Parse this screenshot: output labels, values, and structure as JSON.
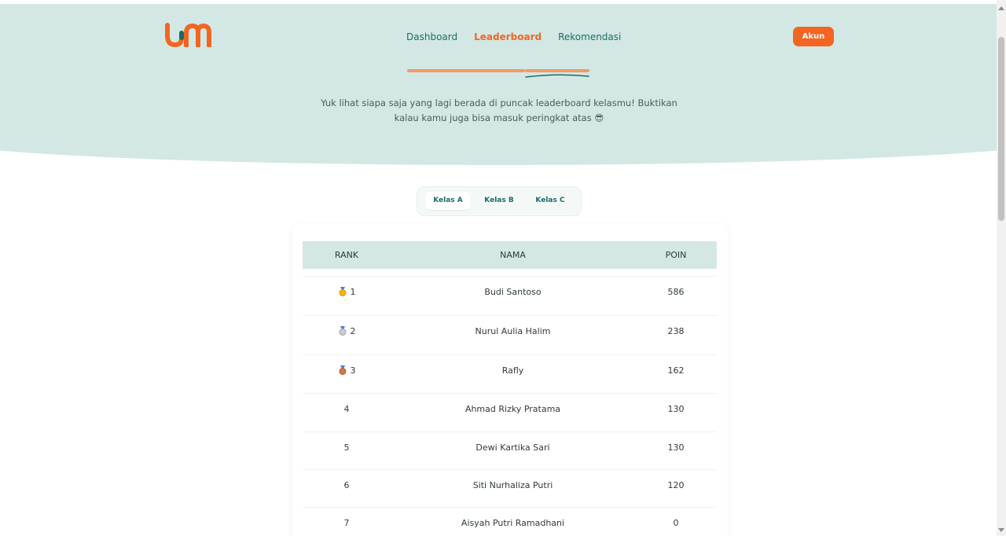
{
  "nav": {
    "items": [
      {
        "label": "Dashboard",
        "active": false
      },
      {
        "label": "Leaderboard",
        "active": true
      },
      {
        "label": "Rekomendasi",
        "active": false
      }
    ],
    "account_label": "Akun"
  },
  "hero": {
    "subtitle_line1": "Yuk lihat siapa saja yang lagi berada di puncak leaderboard kelasmu! Buktikan",
    "subtitle_line2": "kalau kamu juga bisa masuk peringkat atas 😎"
  },
  "tabs": [
    {
      "label": "Kelas A",
      "active": true
    },
    {
      "label": "Kelas B",
      "active": false
    },
    {
      "label": "Kelas C",
      "active": false
    }
  ],
  "table": {
    "headers": {
      "rank": "RANK",
      "name": "NAMA",
      "points": "POIN"
    },
    "rows": [
      {
        "rank": "1",
        "medal": "gold-medal-icon",
        "name": "Budi Santoso",
        "points": "586"
      },
      {
        "rank": "2",
        "medal": "silver-medal-icon",
        "name": "Nurul Aulia Halim",
        "points": "238"
      },
      {
        "rank": "3",
        "medal": "bronze-medal-icon",
        "name": "Rafly",
        "points": "162"
      },
      {
        "rank": "4",
        "medal": "",
        "name": "Ahmad Rizky Pratama",
        "points": "130"
      },
      {
        "rank": "5",
        "medal": "",
        "name": "Dewi Kartika Sari",
        "points": "130"
      },
      {
        "rank": "6",
        "medal": "",
        "name": "Siti Nurhaliza Putri",
        "points": "120"
      },
      {
        "rank": "7",
        "medal": "",
        "name": "Aisyah Putri Ramadhani",
        "points": "0"
      }
    ]
  },
  "colors": {
    "brand_orange": "#f26522",
    "brand_teal": "#1b6b68",
    "hero_bg": "#d3e8e4"
  }
}
